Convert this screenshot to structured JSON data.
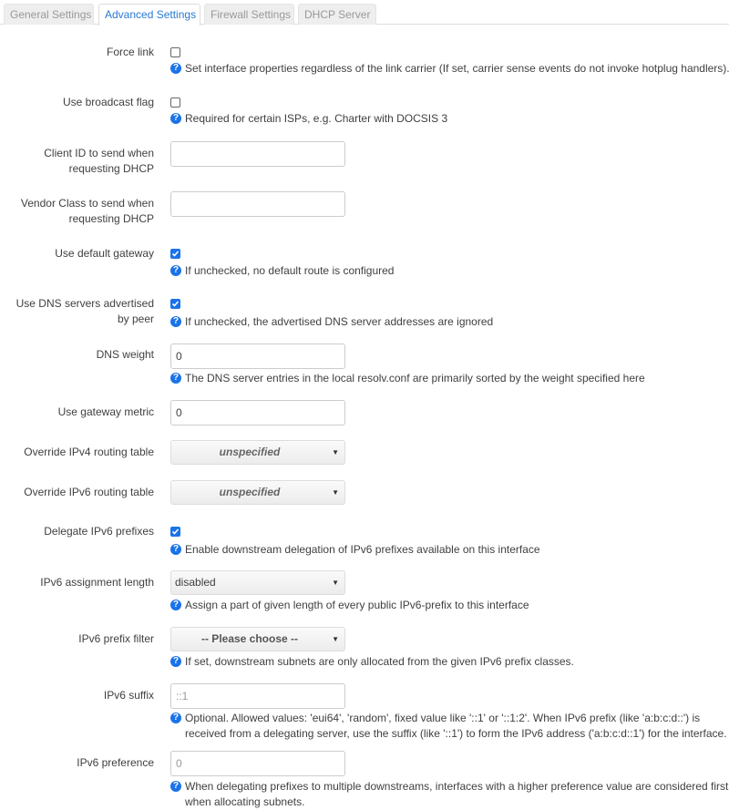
{
  "tabs": [
    {
      "label": "General Settings",
      "active": false
    },
    {
      "label": "Advanced Settings",
      "active": true
    },
    {
      "label": "Firewall Settings",
      "active": false
    },
    {
      "label": "DHCP Server",
      "active": false
    }
  ],
  "fields": {
    "force_link": {
      "label": "Force link",
      "checked": false,
      "help": "Set interface properties regardless of the link carrier (If set, carrier sense events do not invoke hotplug handlers)."
    },
    "broadcast_flag": {
      "label": "Use broadcast flag",
      "checked": false,
      "help": "Required for certain ISPs, e.g. Charter with DOCSIS 3"
    },
    "client_id": {
      "label_line1": "Client ID to send when",
      "label_line2": "requesting DHCP",
      "value": ""
    },
    "vendor_class": {
      "label_line1": "Vendor Class to send when",
      "label_line2": "requesting DHCP",
      "value": ""
    },
    "default_gateway": {
      "label": "Use default gateway",
      "checked": true,
      "help": "If unchecked, no default route is configured"
    },
    "peer_dns": {
      "label_line1": "Use DNS servers advertised",
      "label_line2": "by peer",
      "checked": true,
      "help": "If unchecked, the advertised DNS server addresses are ignored"
    },
    "dns_weight": {
      "label": "DNS weight",
      "value": "0",
      "help": "The DNS server entries in the local resolv.conf are primarily sorted by the weight specified here"
    },
    "gateway_metric": {
      "label": "Use gateway metric",
      "value": "0"
    },
    "ipv4_table": {
      "label": "Override IPv4 routing table",
      "value": "unspecified"
    },
    "ipv6_table": {
      "label": "Override IPv6 routing table",
      "value": "unspecified"
    },
    "delegate": {
      "label": "Delegate IPv6 prefixes",
      "checked": true,
      "help": "Enable downstream delegation of IPv6 prefixes available on this interface"
    },
    "ip6assign": {
      "label": "IPv6 assignment length",
      "value": "disabled",
      "help": "Assign a part of given length of every public IPv6-prefix to this interface"
    },
    "ip6class": {
      "label": "IPv6 prefix filter",
      "value": "-- Please choose --",
      "help": "If set, downstream subnets are only allocated from the given IPv6 prefix classes."
    },
    "ip6suffix": {
      "label": "IPv6 suffix",
      "placeholder": "::1",
      "help_line1": "Optional. Allowed values: 'eui64', 'random', fixed value like '::1' or '::1:2'. When IPv6 prefix (like 'a:b:c:d::') is",
      "help_line2": "received from a delegating server, use the suffix (like '::1') to form the IPv6 address ('a:b:c:d::1') for the interface."
    },
    "ip6pref": {
      "label": "IPv6 preference",
      "placeholder": "0",
      "help_line1": "When delegating prefixes to multiple downstreams, interfaces with a higher preference value are considered first",
      "help_line2": "when allocating subnets."
    }
  },
  "icons": {
    "help": "?",
    "select_arrow": "▼"
  }
}
